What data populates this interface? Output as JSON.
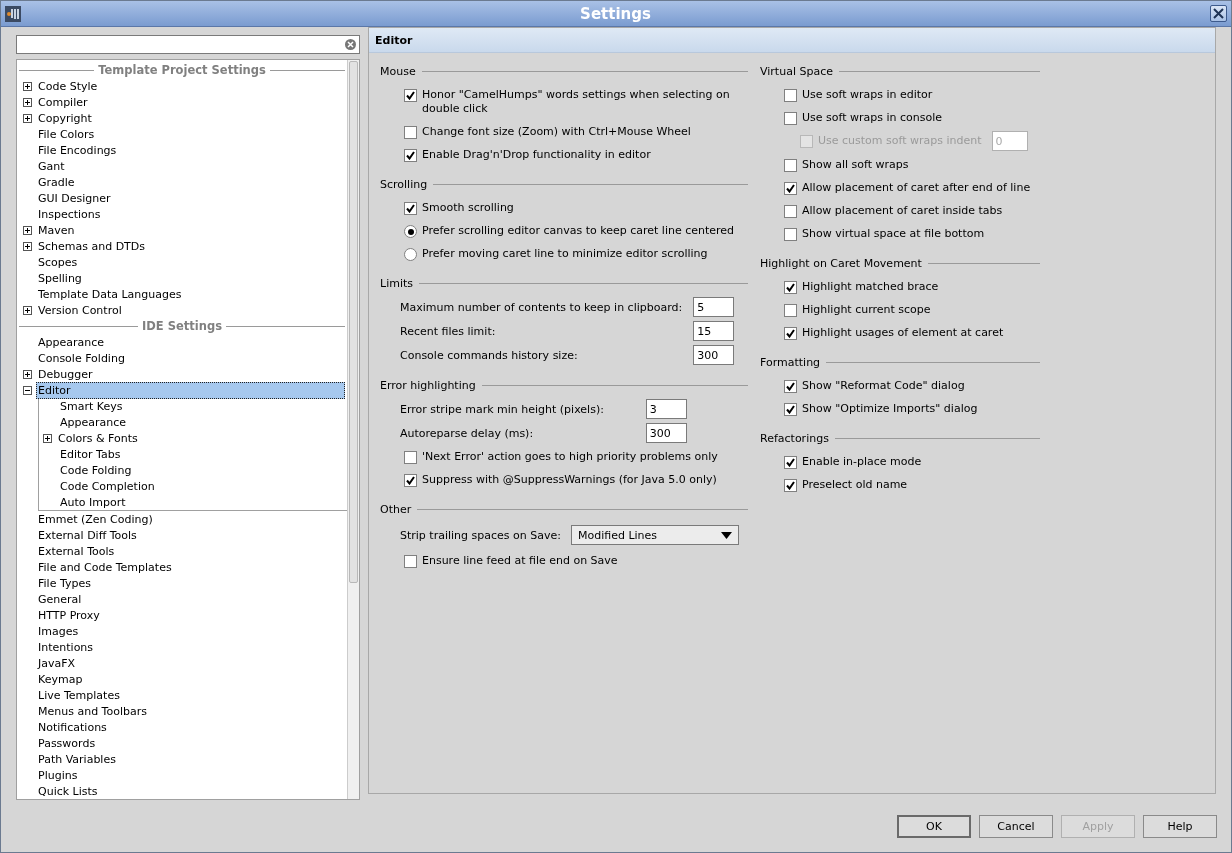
{
  "window": {
    "title": "Settings"
  },
  "sidebar": {
    "groups": [
      {
        "header": "Template Project Settings",
        "items": [
          {
            "label": "Code Style",
            "expanded": false,
            "selected": false
          },
          {
            "label": "Compiler",
            "expanded": false,
            "selected": false
          },
          {
            "label": "Copyright",
            "expanded": false,
            "selected": false
          },
          {
            "label": "File Colors",
            "selected": false
          },
          {
            "label": "File Encodings",
            "selected": false
          },
          {
            "label": "Gant",
            "selected": false
          },
          {
            "label": "Gradle",
            "selected": false
          },
          {
            "label": "GUI Designer",
            "selected": false
          },
          {
            "label": "Inspections",
            "selected": false
          },
          {
            "label": "Maven",
            "expanded": false,
            "selected": false
          },
          {
            "label": "Schemas and DTDs",
            "expanded": false,
            "selected": false
          },
          {
            "label": "Scopes",
            "selected": false
          },
          {
            "label": "Spelling",
            "selected": false
          },
          {
            "label": "Template Data Languages",
            "selected": false
          },
          {
            "label": "Version Control",
            "expanded": false,
            "selected": false
          }
        ]
      },
      {
        "header": "IDE Settings",
        "items": [
          {
            "label": "Appearance",
            "selected": false
          },
          {
            "label": "Console Folding",
            "selected": false
          },
          {
            "label": "Debugger",
            "expanded": false,
            "selected": false
          },
          {
            "label": "Editor",
            "expanded": true,
            "selected": true,
            "children": [
              {
                "label": "Smart Keys",
                "selected": false
              },
              {
                "label": "Appearance",
                "selected": false
              },
              {
                "label": "Colors & Fonts",
                "expanded": false,
                "selected": false
              },
              {
                "label": "Editor Tabs",
                "selected": false
              },
              {
                "label": "Code Folding",
                "selected": false
              },
              {
                "label": "Code Completion",
                "selected": false
              },
              {
                "label": "Auto Import",
                "selected": false
              }
            ]
          },
          {
            "label": "Emmet (Zen Coding)",
            "selected": false
          },
          {
            "label": "External Diff Tools",
            "selected": false
          },
          {
            "label": "External Tools",
            "selected": false
          },
          {
            "label": "File and Code Templates",
            "selected": false
          },
          {
            "label": "File Types",
            "selected": false
          },
          {
            "label": "General",
            "selected": false
          },
          {
            "label": "HTTP Proxy",
            "selected": false
          },
          {
            "label": "Images",
            "selected": false
          },
          {
            "label": "Intentions",
            "selected": false
          },
          {
            "label": "JavaFX",
            "selected": false
          },
          {
            "label": "Keymap",
            "selected": false
          },
          {
            "label": "Live Templates",
            "selected": false
          },
          {
            "label": "Menus and Toolbars",
            "selected": false
          },
          {
            "label": "Notifications",
            "selected": false
          },
          {
            "label": "Passwords",
            "selected": false
          },
          {
            "label": "Path Variables",
            "selected": false
          },
          {
            "label": "Plugins",
            "selected": false
          },
          {
            "label": "Quick Lists",
            "selected": false
          }
        ]
      }
    ]
  },
  "panel": {
    "title": "Editor",
    "columns": [
      [
        {
          "title": "Mouse",
          "items": [
            {
              "kind": "checkbox",
              "label": "Honor \"CamelHumps\" words settings when selecting on double click",
              "checked": true
            },
            {
              "kind": "checkbox",
              "label": "Change font size (Zoom) with Ctrl+Mouse Wheel",
              "checked": false
            },
            {
              "kind": "checkbox",
              "label": "Enable Drag'n'Drop functionality in editor",
              "checked": true
            }
          ]
        },
        {
          "title": "Scrolling",
          "items": [
            {
              "kind": "checkbox",
              "label": "Smooth scrolling",
              "checked": true
            },
            {
              "kind": "radio",
              "label": "Prefer scrolling editor canvas to keep caret line centered",
              "selected": true
            },
            {
              "kind": "radio",
              "label": "Prefer moving caret line to minimize editor scrolling",
              "selected": false
            }
          ]
        },
        {
          "title": "Limits",
          "items": [
            {
              "kind": "number",
              "label": "Maximum number of contents to keep in clipboard:",
              "value": "5"
            },
            {
              "kind": "number",
              "label": "Recent files limit:",
              "value": "15"
            },
            {
              "kind": "number",
              "label": "Console commands history size:",
              "value": "300"
            }
          ]
        },
        {
          "title": "Error highlighting",
          "items": [
            {
              "kind": "number",
              "label": "Error stripe mark min height (pixels):",
              "value": "3"
            },
            {
              "kind": "number",
              "label": "Autoreparse delay (ms):",
              "value": "300"
            },
            {
              "kind": "checkbox",
              "label": "'Next Error' action goes to high priority problems only",
              "checked": false
            },
            {
              "kind": "checkbox",
              "label": "Suppress with @SuppressWarnings (for Java 5.0 only)",
              "checked": true
            }
          ]
        },
        {
          "title": "Other",
          "items": [
            {
              "kind": "dropdown",
              "label": "Strip trailing spaces on Save:",
              "value": "Modified Lines"
            },
            {
              "kind": "checkbox",
              "label": "Ensure line feed at file end on Save",
              "checked": false
            }
          ]
        }
      ],
      [
        {
          "title": "Virtual Space",
          "items": [
            {
              "kind": "checkbox",
              "label": "Use soft wraps in editor",
              "checked": false
            },
            {
              "kind": "checkbox",
              "label": "Use soft wraps in console",
              "checked": false,
              "children": [
                {
                  "kind": "checkbox",
                  "label": "Use custom soft wraps indent",
                  "checked": false,
                  "disabled": true,
                  "value": "0"
                }
              ]
            },
            {
              "kind": "checkbox",
              "label": "Show all soft wraps",
              "checked": false
            },
            {
              "kind": "checkbox",
              "label": "Allow placement of caret after end of line",
              "checked": true
            },
            {
              "kind": "checkbox",
              "label": "Allow placement of caret inside tabs",
              "checked": false
            },
            {
              "kind": "checkbox",
              "label": "Show virtual space at file bottom",
              "checked": false
            }
          ]
        },
        {
          "title": "Highlight on Caret Movement",
          "items": [
            {
              "kind": "checkbox",
              "label": "Highlight matched brace",
              "checked": true
            },
            {
              "kind": "checkbox",
              "label": "Highlight current scope",
              "checked": false
            },
            {
              "kind": "checkbox",
              "label": "Highlight usages of element at caret",
              "checked": true
            }
          ]
        },
        {
          "title": "Formatting",
          "items": [
            {
              "kind": "checkbox",
              "label": "Show \"Reformat Code\" dialog",
              "checked": true
            },
            {
              "kind": "checkbox",
              "label": "Show \"Optimize Imports\" dialog",
              "checked": true
            }
          ]
        },
        {
          "title": "Refactorings",
          "items": [
            {
              "kind": "checkbox",
              "label": "Enable in-place mode",
              "checked": true
            },
            {
              "kind": "checkbox",
              "label": "Preselect old name",
              "checked": true
            }
          ]
        }
      ]
    ]
  },
  "buttons": [
    {
      "label": "OK",
      "default": true,
      "disabled": false
    },
    {
      "label": "Cancel",
      "default": false,
      "disabled": false
    },
    {
      "label": "Apply",
      "default": false,
      "disabled": true
    },
    {
      "label": "Help",
      "default": false,
      "disabled": false
    }
  ]
}
